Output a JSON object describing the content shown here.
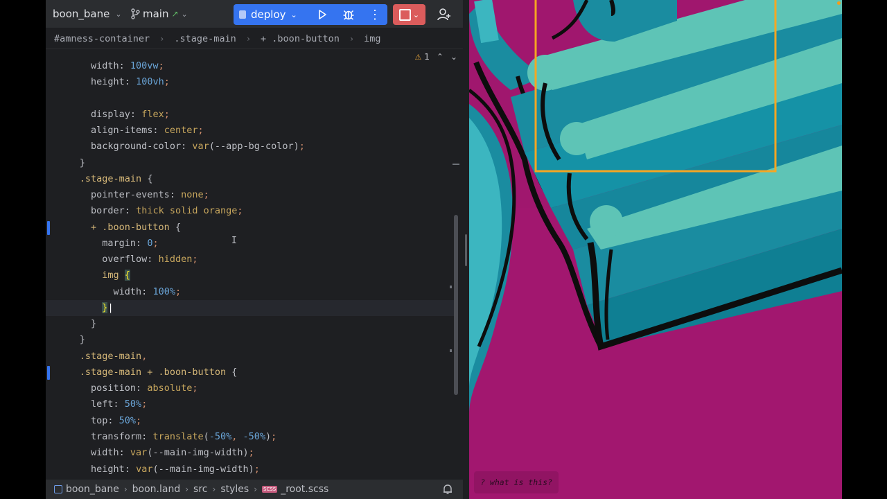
{
  "toolbar": {
    "project_name": "boon_bane",
    "branch": "main",
    "run_config": "deploy"
  },
  "breadcrumbs": [
    "#amness-container",
    ".stage-main",
    "+ .boon-button",
    "img"
  ],
  "inspection": {
    "warnings": "1"
  },
  "code_lines": [
    "    width: 100vw;",
    "    height: 100vh;",
    "",
    "    display: flex;",
    "    align-items: center;",
    "    background-color: var(--app-bg-color);",
    "  }",
    "  .stage-main {",
    "    pointer-events: none;",
    "    border: thick solid orange;",
    "    + .boon-button {",
    "      margin: 0;",
    "      overflow: hidden;",
    "      img {",
    "        width: 100%;",
    "      }",
    "    }",
    "  }",
    "  .stage-main,",
    "  .stage-main + .boon-button {",
    "    position: absolute;",
    "    left: 50%;",
    "    top: 50%;",
    "    transform: translate(-50%, -50%);",
    "    width: var(--main-img-width);",
    "    height: var(--main-img-width);"
  ],
  "status_path": [
    "boon_bane",
    "boon.land",
    "src",
    "styles",
    "_root.scss"
  ],
  "preview": {
    "help_text": "? what is this?",
    "bg_color": "#a0176e",
    "stripe_color": "#5ec4b6",
    "border_color": "#f5a623"
  }
}
